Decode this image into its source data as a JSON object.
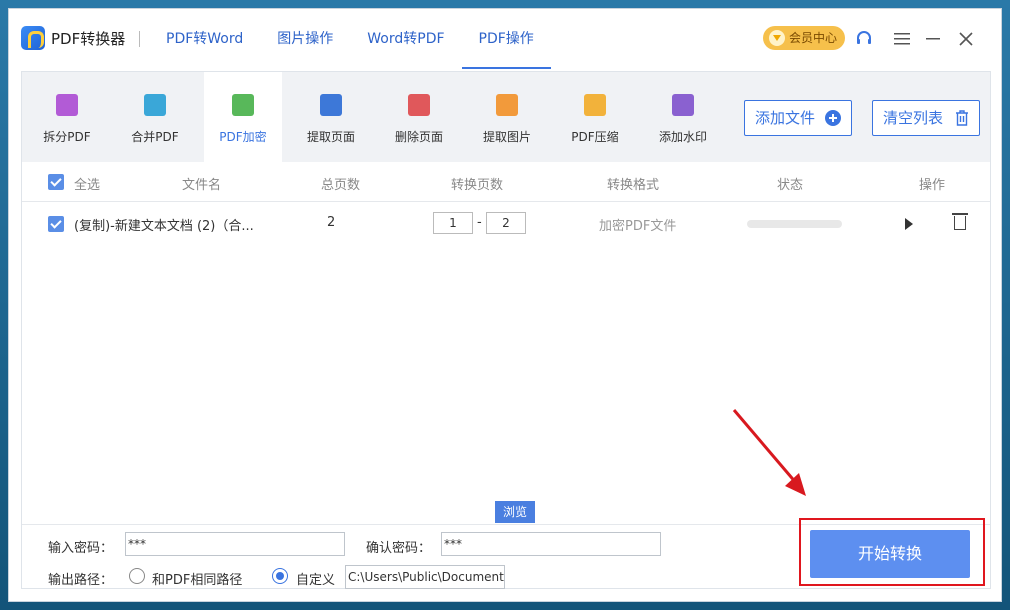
{
  "app": {
    "name": "PDF转换器"
  },
  "nav": {
    "tabs": [
      "PDF转Word",
      "图片操作",
      "Word转PDF",
      "PDF操作"
    ],
    "active": 3
  },
  "vip_label": "会员中心",
  "tools": [
    {
      "label": "拆分PDF",
      "icon": "split-icon",
      "color": "#b25bd6"
    },
    {
      "label": "合并PDF",
      "icon": "merge-icon",
      "color": "#3aa7d8"
    },
    {
      "label": "PDF加密",
      "icon": "lock-icon",
      "color": "#58b85a"
    },
    {
      "label": "提取页面",
      "icon": "extract-page-icon",
      "color": "#3d78d8"
    },
    {
      "label": "删除页面",
      "icon": "delete-page-icon",
      "color": "#e0585b"
    },
    {
      "label": "提取图片",
      "icon": "image-icon",
      "color": "#f29a3b"
    },
    {
      "label": "PDF压缩",
      "icon": "compress-icon",
      "color": "#f2b23b"
    },
    {
      "label": "添加水印",
      "icon": "watermark-icon",
      "color": "#8a61d0"
    }
  ],
  "actions": {
    "add_files": "添加文件",
    "clear_list": "清空列表"
  },
  "table": {
    "headers": {
      "select_all": "全选",
      "filename": "文件名",
      "total_pages": "总页数",
      "convert_pages": "转换页数",
      "format": "转换格式",
      "status": "状态",
      "operation": "操作"
    },
    "rows": [
      {
        "filename": "(复制)-新建文本文档 (2)（合...",
        "total_pages": "2",
        "page_from": "1",
        "dash": "-",
        "page_to": "2",
        "format": "加密PDF文件",
        "status_progress": 0
      }
    ]
  },
  "bottom": {
    "password_label": "输入密码：",
    "password_value": "***",
    "confirm_label": "确认密码：",
    "confirm_value": "***",
    "output_label": "输出路径：",
    "option_same": "和PDF相同路径",
    "option_custom": "自定义",
    "path_value": "C:\\Users\\Public\\Documents",
    "browse": "浏览",
    "start": "开始转换"
  },
  "colors": {
    "accent": "#3a74e0",
    "start_button": "#5d8ff0",
    "highlight": "#e0161e"
  }
}
